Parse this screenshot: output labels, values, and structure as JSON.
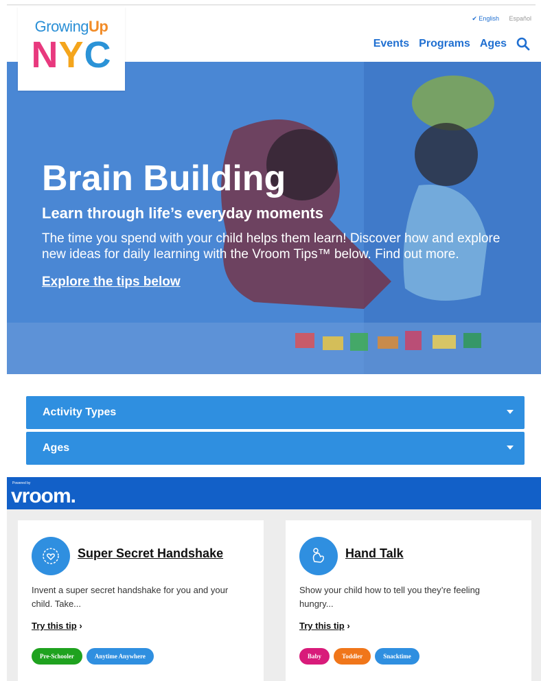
{
  "language": {
    "english": "✔ English",
    "espanol": "Español"
  },
  "logo": {
    "growing": "Growing",
    "up": "Up",
    "n": "N",
    "y": "Y",
    "c": "C"
  },
  "nav": {
    "events": "Events",
    "programs": "Programs",
    "ages": "Ages"
  },
  "hero": {
    "title": "Brain Building",
    "subtitle": "Learn through life’s everyday moments",
    "description": "The time you spend with your child helps them learn! Discover how and explore new ideas for daily learning with the Vroom Tips™ below.",
    "find_out_more": "Find out more",
    "period": ".",
    "explore": "Explore the tips below"
  },
  "filters": {
    "activity_types": "Activity Types",
    "ages": "Ages"
  },
  "vroom": {
    "powered_by": "Powered by",
    "logo_text": "vroom."
  },
  "cards": [
    {
      "title": "Super Secret Handshake",
      "description": "Invent a super secret handshake for you and your child. Take...",
      "try_label": "Try this tip",
      "tags": [
        {
          "label": "Pre-Schooler",
          "color": "#1fa21f"
        },
        {
          "label": "Anytime Anywhere",
          "color": "#2f8fe0"
        }
      ]
    },
    {
      "title": "Hand Talk",
      "description": "Show your child how to tell you they’re feeling hungry...",
      "try_label": "Try this tip",
      "tags": [
        {
          "label": "Baby",
          "color": "#d81b7a"
        },
        {
          "label": "Toddler",
          "color": "#f0761a"
        },
        {
          "label": "Snacktime",
          "color": "#2f8fe0"
        }
      ]
    }
  ],
  "colors": {
    "primary_blue": "#1f6fd1",
    "filter_blue": "#2f8fe0",
    "vroom_blue": "#1260c8"
  }
}
